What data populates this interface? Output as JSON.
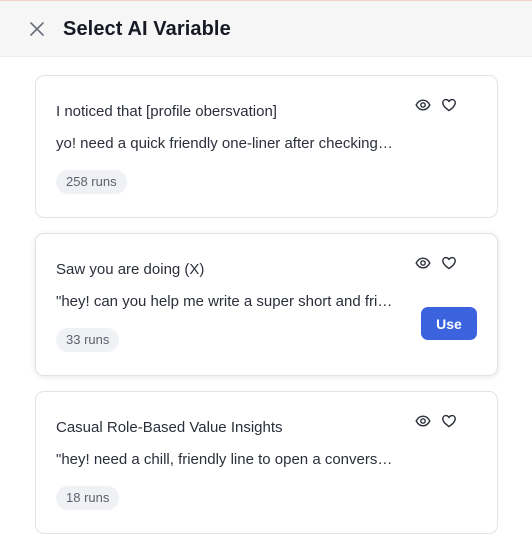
{
  "header": {
    "title": "Select AI Variable",
    "close_icon": "close-icon"
  },
  "colors": {
    "accent": "#3b63de",
    "badge_bg": "#f0f1f4",
    "header_bg": "#f6f6f7"
  },
  "cards": [
    {
      "title": "I noticed that [profile obersvation]",
      "description": "yo! need a quick friendly one-liner after checking out their profile",
      "runs": "258 runs",
      "icons": [
        "eye-icon",
        "heart-icon"
      ]
    },
    {
      "title": "Saw you are doing (X)",
      "description": "\"hey! can you help me write a super short and friendly opener",
      "runs": "33 runs",
      "use_label": "Use",
      "icons": [
        "eye-icon",
        "heart-icon"
      ]
    },
    {
      "title": "Casual Role-Based Value Insights",
      "description": "\"hey! need a chill, friendly line to open a conversation",
      "runs": "18 runs",
      "icons": [
        "eye-icon",
        "heart-icon"
      ]
    }
  ]
}
